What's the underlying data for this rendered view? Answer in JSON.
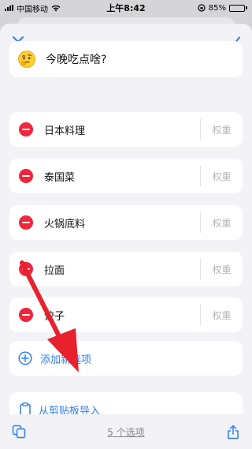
{
  "status": {
    "carrier": "中国移动",
    "time": "上午8:42",
    "battery": "85%",
    "battery_level": 0.85
  },
  "header": {
    "close_icon": "close-icon",
    "done_icon": "checkmark-icon"
  },
  "title": {
    "emoji": "thinking-face",
    "text": "今晚吃点啥?"
  },
  "options": [
    {
      "label": "日本料理",
      "weight_placeholder": "权重"
    },
    {
      "label": "泰国菜",
      "weight_placeholder": "权重"
    },
    {
      "label": "火锅底料",
      "weight_placeholder": "权重"
    },
    {
      "label": "拉面",
      "weight_placeholder": "权重"
    },
    {
      "label": "饺子",
      "weight_placeholder": "权重"
    }
  ],
  "add_option": {
    "label": "添加新选项",
    "icon": "plus-circle-icon"
  },
  "paste_import": {
    "label": "从剪贴板导入",
    "icon": "clipboard-icon"
  },
  "footer": {
    "count_label": "5 个选项",
    "left_icon": "copy-icon",
    "right_icon": "share-icon"
  },
  "colors": {
    "accent": "#2f7ff5",
    "delete": "#f2263b",
    "annotation_arrow": "#e8212e"
  }
}
